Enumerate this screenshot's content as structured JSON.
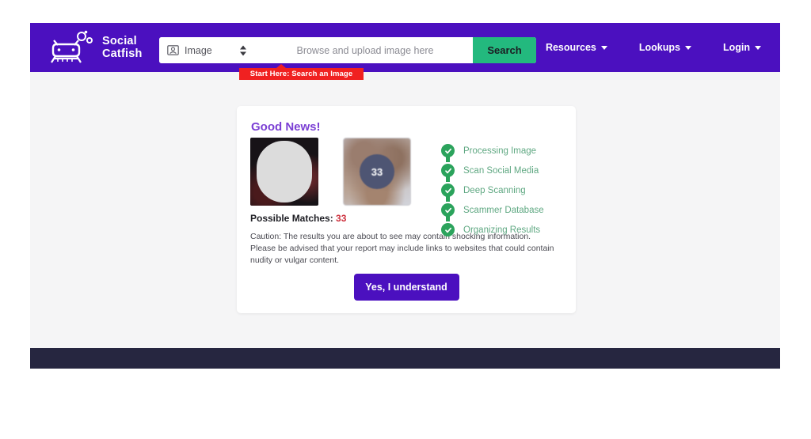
{
  "header": {
    "logo": {
      "icon": "catfish-logo-icon",
      "line1": "Social",
      "line2": "Catfish"
    },
    "search": {
      "type_icon": "image-person-icon",
      "type_value": "Image",
      "spinner_icon": "up-down-arrows-icon",
      "placeholder": "Browse and upload image here",
      "search_label": "Search"
    },
    "tooltip": "Start Here: Search an Image",
    "nav": [
      {
        "label": "Resources",
        "caret": "chevron-down-icon"
      },
      {
        "label": "Lookups",
        "caret": "chevron-down-icon"
      },
      {
        "label": "Login",
        "caret": "chevron-down-icon"
      }
    ]
  },
  "card": {
    "heading": "Good News!",
    "thumbnails": [
      {
        "name": "uploaded-photo-thumbnail",
        "badge": null
      },
      {
        "name": "match-preview-thumbnail",
        "badge": "33"
      }
    ],
    "steps": [
      {
        "label": "Processing Image",
        "icon": "check-circle-icon",
        "complete": true
      },
      {
        "label": "Scan Social Media",
        "icon": "check-circle-icon",
        "complete": true
      },
      {
        "label": "Deep Scanning",
        "icon": "check-circle-icon",
        "complete": true
      },
      {
        "label": "Scammer Database",
        "icon": "check-circle-icon",
        "complete": true
      },
      {
        "label": "Organizing Results",
        "icon": "check-circle-icon",
        "complete": true
      }
    ],
    "matches_label": "Possible Matches:",
    "matches_count": "33",
    "caution": "Caution: The results you are about to see may contain shocking information. Please be advised that your report may include links to websites that could contain nudity or vulgar content.",
    "cta_label": "Yes, I understand"
  },
  "colors": {
    "brand_purple": "#4b10bf",
    "search_green": "#23b97e",
    "tooltip_red": "#f02121",
    "step_green": "#2ba35c",
    "step_text_green": "#5fa882",
    "heading_purple": "#7b3fd4",
    "count_red": "#cd2f3c",
    "footer_navy": "#262640",
    "page_bg": "#f5f5f6"
  }
}
